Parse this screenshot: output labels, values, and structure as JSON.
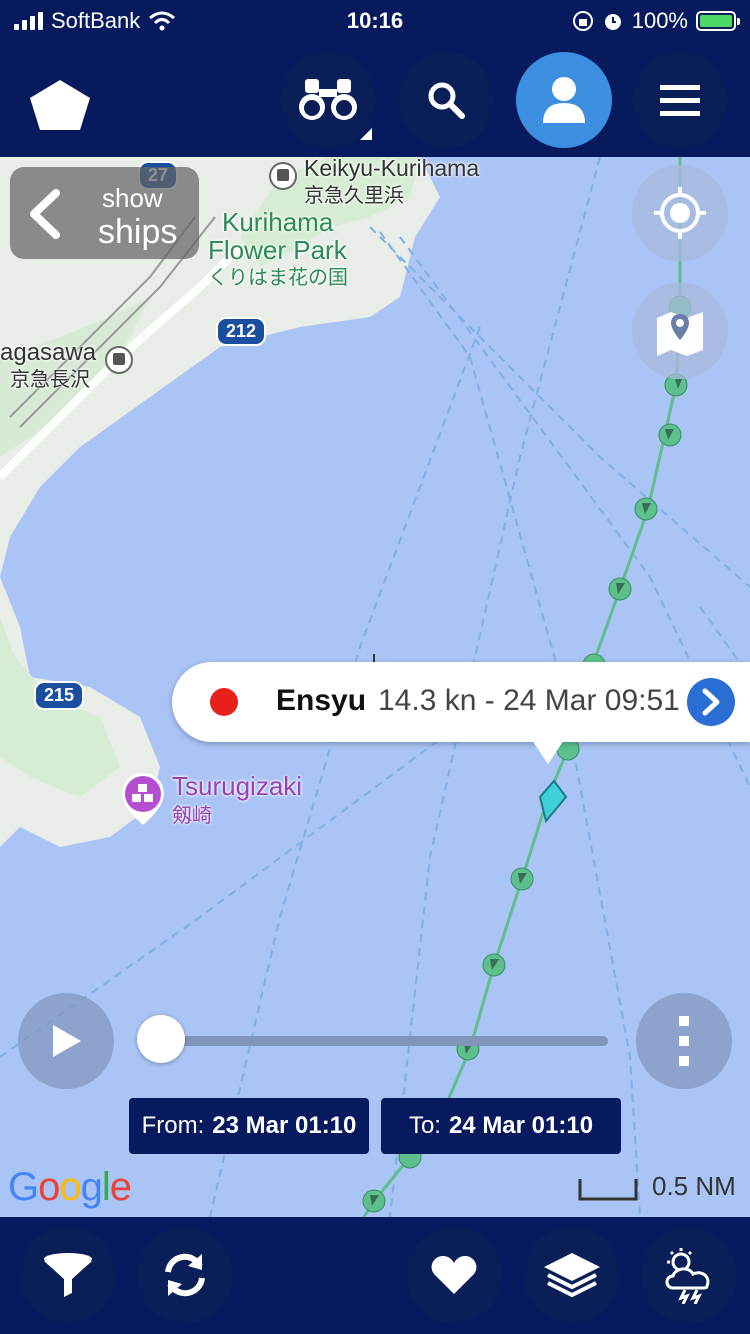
{
  "status_bar": {
    "carrier": "SoftBank",
    "time": "10:16",
    "battery": "100%",
    "icons": [
      "signal-icon",
      "wifi-icon",
      "orientation-lock-icon",
      "alarm-icon",
      "battery-charging-icon"
    ]
  },
  "nav": {
    "logo_icon": "pentagon-logo-icon",
    "buttons": [
      {
        "name": "binoculars-button",
        "icon": "binoculars-icon"
      },
      {
        "name": "search-button",
        "icon": "search-icon"
      },
      {
        "name": "account-button",
        "icon": "user-icon",
        "active": true
      },
      {
        "name": "menu-button",
        "icon": "hamburger-icon"
      }
    ]
  },
  "map": {
    "show_ships": {
      "line1": "show",
      "line2": "ships"
    },
    "places": {
      "keikyu_kurihama": "Keikyu-Kurihama",
      "keikyu_kurihama_jp": "京急久里浜",
      "kurihama_flower_park_1": "Kurihama",
      "kurihama_flower_park_2": "Flower Park",
      "kurihama_flower_park_jp": "くりはま花の国",
      "nagasawa": "agasawa",
      "nagasawa_jp": "京急長沢",
      "tsurugizaki": "Tsurugizaki",
      "tsurugizaki_jp": "剱崎"
    },
    "route_badges": {
      "r27": "27",
      "r212": "212",
      "r215": "215"
    },
    "ship_popup": {
      "name": "Ensyu",
      "info": "14.3 kn - 24 Mar 09:51",
      "status_color": "#e8201a"
    },
    "playback": {
      "progress": 0
    },
    "from": {
      "label": "From:",
      "value": "23 Mar 01:10"
    },
    "to": {
      "label": "To:",
      "value": "24 Mar 01:10"
    },
    "attribution": "Google",
    "scale_label": "0.5 NM"
  },
  "bottom_bar": {
    "buttons": [
      {
        "name": "filter-button",
        "icon": "filter-icon"
      },
      {
        "name": "refresh-button",
        "icon": "refresh-icon"
      },
      {
        "name": "favorites-button",
        "icon": "heart-icon"
      },
      {
        "name": "layers-button",
        "icon": "layers-icon"
      },
      {
        "name": "weather-button",
        "icon": "weather-icon"
      }
    ]
  },
  "colors": {
    "bar": "#071a5e",
    "sea": "#a9c4f5",
    "land": "#e9eef0",
    "track": "#5cbf8c",
    "accent": "#3d8fe0"
  }
}
